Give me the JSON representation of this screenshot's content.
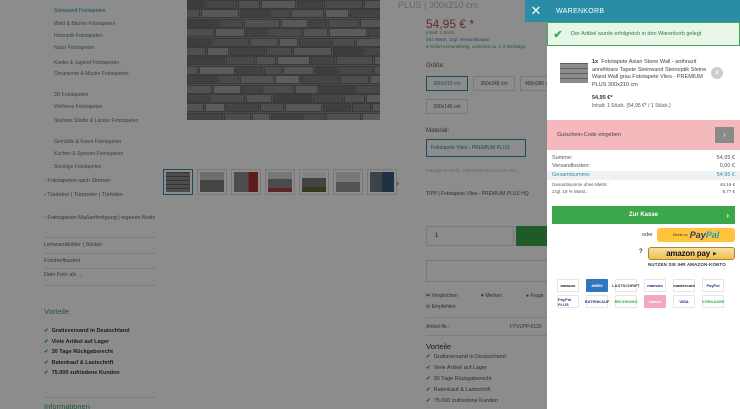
{
  "sidebar": {
    "categories": [
      {
        "label": "Steinwand Fototapeten",
        "level": "sub",
        "active": true
      },
      {
        "label": "Wald & Bäume Fototapeten",
        "level": "sub"
      },
      {
        "label": "Holzoptik Fototapeten",
        "level": "sub"
      },
      {
        "label": "Natur Fototapeten",
        "level": "sub"
      },
      {
        "label": "Kinder & Jugend Fototapeten",
        "level": "sub"
      },
      {
        "label": "Ornamente & Muster Fototapeten",
        "level": "sub"
      },
      {
        "label": "3D Fototapeten",
        "level": "sub"
      },
      {
        "label": "Wellness Fototapeten",
        "level": "sub"
      },
      {
        "label": "Skylines Städte & Länder Fototapeten",
        "level": "sub"
      },
      {
        "label": "Gemälde & Kunst Fototapeten",
        "level": "sub"
      },
      {
        "label": "Küchen & Speisen Fototapeten",
        "level": "sub"
      },
      {
        "label": "Sonstige Fototapeten",
        "level": "sub"
      },
      {
        "label": "› Fototapeten nach Zimmer",
        "level": "main"
      },
      {
        "label": "› Türdekor | Türposter | Türfolien",
        "level": "main"
      },
      {
        "label": "› Fototapeten Maßanfertigung | eigenes Motiv",
        "level": "main"
      },
      {
        "label": "Leinwandbilder | Sticker",
        "level": "top"
      },
      {
        "label": "Fotohiefbasteri",
        "level": "top"
      },
      {
        "label": "Dein Foto als ...",
        "level": "top"
      }
    ],
    "vorteile_heading": "Vorteile",
    "vorteile": [
      "Gratisversand in Deutschland",
      "Viele Artikel auf Lager",
      "30 Tage Rückgaberecht",
      "Ratenkauf & Lastschrift",
      "75.000 zufriedene Kunden"
    ],
    "info_heading": "Informationen"
  },
  "product": {
    "title": "PLUS | 300x210 cm",
    "price": "54,95 € *",
    "content": "Inhalt: 1 Stück",
    "vat": "inkl. MwSt. zzgl. Versandkosten",
    "shipping": "● Sofort versandfertig, Lieferzeit ca. 1-3 Werktage",
    "size_label": "Größe:",
    "sizes": [
      "300x210 cm",
      "350x245 cm",
      "400x280 cm",
      "200x140 cm"
    ],
    "material_label": "Material:",
    "material_selected": "Fototapete Vlies - PREMIUM PLUS",
    "material_hint": "Fototapete Textil - PREMIUM EXCLUSIV WG",
    "tipp": "TIPP | Fototapete Vlies - PREMIUM PLUS HQ",
    "quantity": "1",
    "actions": {
      "compare": "Vergleichen",
      "wishlist": "Merken",
      "question": "Frage",
      "recommend": "Empfehlen"
    },
    "article_label": "Artikel-Nr.:",
    "article_no": "FTVLPP-0120",
    "vorteile_heading": "Vorteile",
    "vorteile": [
      "Gratisversand in Deutschland",
      "Viele Artikel auf Lager",
      "30 Tage Rückgaberecht",
      "Ratenkauf & Lastschrift",
      "75.000 zufriedene Kunden"
    ]
  },
  "cart": {
    "close_icon": "✕",
    "title": "WARENKORB",
    "success_message": "Der Artikel wurde erfolgreich in den Warenkorb gelegt",
    "item": {
      "qty": "1x",
      "name": "Fototapete Asian Stone Wall - anthrazit anreihbare Tapete Steinwand Steinoptik Steine Wand Wall grau Fototapete Vlies - PREMIUM PLUS 300x210 cm",
      "price": "54,95 €*",
      "info": "Inhalt: 1 Stück. (54,95 €* / 1 Stück.)"
    },
    "voucher_label": "Gutschein-Code eingeben",
    "summary": {
      "subtotal_label": "Summe:",
      "subtotal": "54,95 €",
      "shipping_label": "Versandkosten:",
      "shipping": "0,00 €",
      "total_label": "Gesamtsumme:",
      "total": "54,95 €",
      "net_label": "Gesamtsumme ohne MwSt.:",
      "net": "46,18 €",
      "vat_label": "zzgl. 19 % MwSt.:",
      "vat": "8,77 €"
    },
    "checkout_label": "Zur Kasse",
    "or_label": "oder",
    "paypal": {
      "small": "Direkt zu",
      "pay": "Pay",
      "pal": "Pal"
    },
    "amazon": {
      "label": "amazon pay",
      "sub": "NUTZEN SIE IHR AMAZON-KONTO",
      "help": "?"
    },
    "payment_logos": [
      {
        "name": "amazon",
        "text": "amazon",
        "bg": "#ffffff",
        "fg": "#222222"
      },
      {
        "name": "amex",
        "text": "AMEX",
        "bg": "#2e77bc",
        "fg": "#ffffff"
      },
      {
        "name": "lastschrift",
        "text": "LASTSCHRIFT",
        "bg": "#ffffff",
        "fg": "#444444"
      },
      {
        "name": "maestro",
        "text": "maestro",
        "bg": "#ffffff",
        "fg": "#1a1a6e"
      },
      {
        "name": "mastercard",
        "text": "mastercard",
        "bg": "#ffffff",
        "fg": "#222222"
      },
      {
        "name": "paypal",
        "text": "PayPal",
        "bg": "#ffffff",
        "fg": "#253b80"
      },
      {
        "name": "paypal-plus",
        "text": "PayPal PLUS",
        "bg": "#ffffff",
        "fg": "#253b80"
      },
      {
        "name": "ratenkauf",
        "text": "RATENKAUF",
        "bg": "#ffffff",
        "fg": "#253b80"
      },
      {
        "name": "rechnung",
        "text": "RECHNUNG",
        "bg": "#ffffff",
        "fg": "#3aa74b"
      },
      {
        "name": "klarna",
        "text": "klarna",
        "bg": "#f4a7c2",
        "fg": "#ffffff"
      },
      {
        "name": "visa",
        "text": "VISA",
        "bg": "#ffffff",
        "fg": "#1a1f71"
      },
      {
        "name": "vorkasse",
        "text": "VORKASSE",
        "bg": "#ffffff",
        "fg": "#3aa74b"
      }
    ]
  },
  "colors": {
    "accent": "#2a8da8",
    "success": "#3aa74b",
    "price": "#c54a52",
    "voucher_bg": "#f5b8bd"
  }
}
